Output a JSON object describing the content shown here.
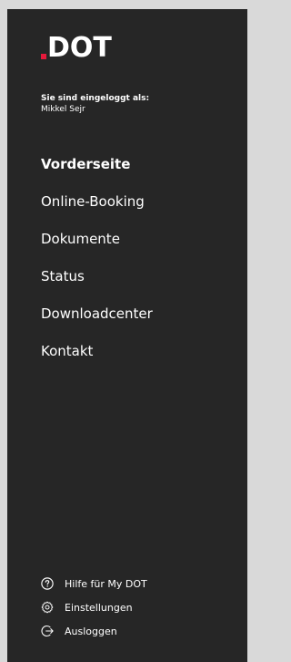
{
  "brand": {
    "logo_text": "DOT",
    "accent_color": "#e5193b"
  },
  "user": {
    "logged_in_label": "Sie sind eingeloggt als:",
    "name": "Mikkel Sejr"
  },
  "nav": {
    "items": [
      {
        "label": "Vorderseite",
        "active": true
      },
      {
        "label": "Online-Booking",
        "active": false
      },
      {
        "label": "Dokumente",
        "active": false
      },
      {
        "label": "Status",
        "active": false
      },
      {
        "label": "Downloadcenter",
        "active": false
      },
      {
        "label": "Kontakt",
        "active": false
      }
    ]
  },
  "footer": {
    "help": {
      "label": "Hilfe für My DOT",
      "icon": "help-icon"
    },
    "settings": {
      "label": "Einstellungen",
      "icon": "gear-icon"
    },
    "logout": {
      "label": "Ausloggen",
      "icon": "logout-icon"
    }
  }
}
